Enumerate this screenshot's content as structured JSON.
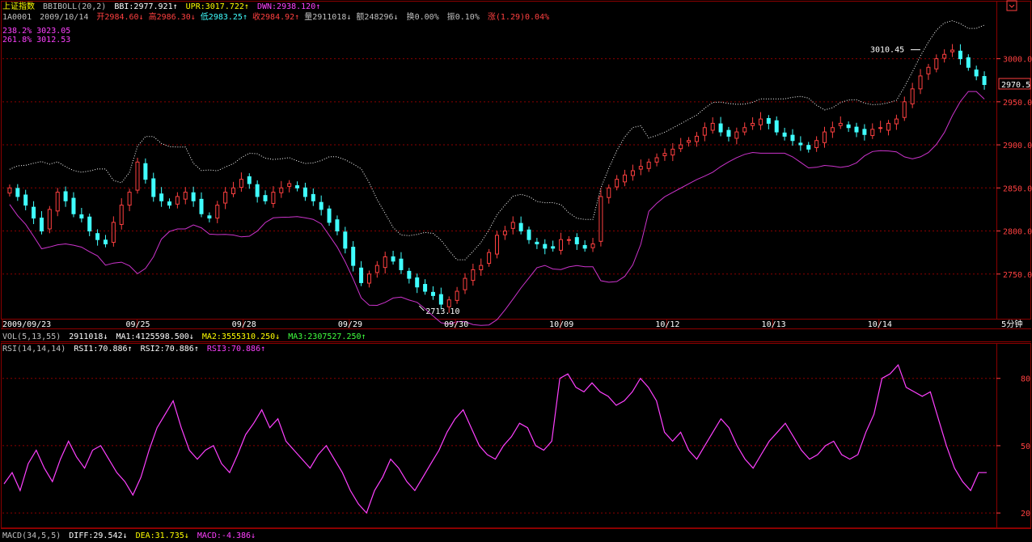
{
  "header": {
    "index_name": "上证指数",
    "indicator": "BBIBOLL(20,2)",
    "bbi": "BBI:2977.921↑",
    "upr": "UPR:3017.722↑",
    "dwn": "DWN:2938.120↑",
    "code": "1A0001",
    "date": "2009/10/14",
    "open": "开2984.60↓",
    "high": "高2986.30↓",
    "low": "低2983.25↑",
    "close": "收2984.92↑",
    "volume": "量2911018↓",
    "amount": "额248296↓",
    "turnover": "换0.00%",
    "amplitude": "振0.10%",
    "change": "涨(1.29)0.04%",
    "fib1": "238.2% 3023.05",
    "fib2": "261.8% 3012.53"
  },
  "vol_line": {
    "label": "VOL(5,13,55)",
    "value": "2911018↓",
    "ma1": "MA1:4125598.500↓",
    "ma2": "MA2:3555310.250↓",
    "ma3": "MA3:2307527.250↑"
  },
  "rsi_line": {
    "label": "RSI(14,14,14)",
    "rsi1": "RSI1:70.886↑",
    "rsi2": "RSI2:70.886↑",
    "rsi3": "RSI3:70.886↑"
  },
  "macd_line": {
    "label": "MACD(34,5,5)",
    "diff": "DIFF:29.542↓",
    "dea": "DEA:31.735↓",
    "macd": "MACD:-4.386↓"
  },
  "colors": {
    "up": "#ff4040",
    "down": "#40ffff",
    "grid": "#8b0000",
    "rsi": "#ff40ff",
    "band": "#ffffff",
    "lower": "#cc33cc"
  },
  "chart_data": [
    {
      "type": "candlestick",
      "ylim": [
        2700,
        3040
      ],
      "yticks": [
        2750,
        2800,
        2850,
        2900,
        2950,
        3000
      ],
      "ytick_labels": [
        "2750.0",
        "2800.0",
        "2850.0",
        "2900.0",
        "2950.0",
        "3000.0"
      ],
      "current_price_label": "2970.5",
      "current_price": 2970.5,
      "date_labels": [
        "2009/09/23",
        "09/25",
        "09/28",
        "09/29",
        "09/30",
        "10/09",
        "10/12",
        "10/13",
        "10/14"
      ],
      "date_positions": [
        0.0,
        0.137,
        0.245,
        0.353,
        0.461,
        0.568,
        0.676,
        0.784,
        0.892
      ],
      "period_label": "5分钟",
      "annotations": [
        {
          "text": "3010.45",
          "value": 3010.45,
          "position": 0.925
        },
        {
          "text": "2713.10",
          "value": 2713.1,
          "position": 0.42
        }
      ],
      "close_path": [
        2850,
        2840,
        2830,
        2815,
        2800,
        2825,
        2845,
        2835,
        2820,
        2815,
        2800,
        2790,
        2785,
        2810,
        2830,
        2845,
        2880,
        2860,
        2840,
        2835,
        2830,
        2840,
        2845,
        2835,
        2820,
        2815,
        2830,
        2845,
        2850,
        2860,
        2855,
        2840,
        2835,
        2845,
        2850,
        2855,
        2850,
        2840,
        2835,
        2825,
        2810,
        2800,
        2780,
        2760,
        2740,
        2750,
        2760,
        2770,
        2765,
        2755,
        2745,
        2735,
        2730,
        2725,
        2715,
        2720,
        2730,
        2745,
        2755,
        2760,
        2775,
        2795,
        2800,
        2810,
        2800,
        2790,
        2785,
        2780,
        2780,
        2790,
        2790,
        2785,
        2780,
        2785,
        2840,
        2850,
        2860,
        2865,
        2870,
        2875,
        2880,
        2885,
        2890,
        2895,
        2900,
        2905,
        2910,
        2920,
        2925,
        2915,
        2910,
        2915,
        2920,
        2925,
        2930,
        2925,
        2915,
        2910,
        2905,
        2900,
        2895,
        2905,
        2915,
        2920,
        2925,
        2920,
        2915,
        2912,
        2918,
        2920,
        2925,
        2930,
        2950,
        2965,
        2980,
        2990,
        3000,
        3005,
        3010,
        3000,
        2990,
        2980,
        2970
      ]
    },
    {
      "type": "line",
      "name": "RSI(14,14,14)",
      "ylim": [
        15,
        90
      ],
      "yticks": [
        20,
        50,
        80
      ],
      "ytick_labels": [
        "20",
        "50",
        "80"
      ],
      "values": [
        33,
        38,
        30,
        42,
        48,
        40,
        34,
        44,
        52,
        45,
        40,
        48,
        50,
        44,
        38,
        34,
        28,
        36,
        48,
        58,
        64,
        70,
        58,
        48,
        44,
        48,
        50,
        42,
        38,
        46,
        55,
        60,
        66,
        58,
        62,
        52,
        48,
        44,
        40,
        46,
        50,
        44,
        38,
        30,
        24,
        20,
        30,
        36,
        44,
        40,
        34,
        30,
        36,
        42,
        48,
        56,
        62,
        66,
        58,
        50,
        46,
        44,
        50,
        54,
        60,
        58,
        50,
        48,
        52,
        80,
        82,
        76,
        74,
        78,
        74,
        72,
        68,
        70,
        74,
        80,
        76,
        70,
        56,
        52,
        56,
        48,
        44,
        50,
        56,
        62,
        58,
        50,
        44,
        40,
        46,
        52,
        56,
        60,
        54,
        48,
        44,
        46,
        50,
        52,
        46,
        44,
        46,
        56,
        64,
        80,
        82,
        86,
        76,
        74,
        72,
        74,
        62,
        50,
        40,
        34,
        30,
        38,
        38
      ]
    }
  ]
}
